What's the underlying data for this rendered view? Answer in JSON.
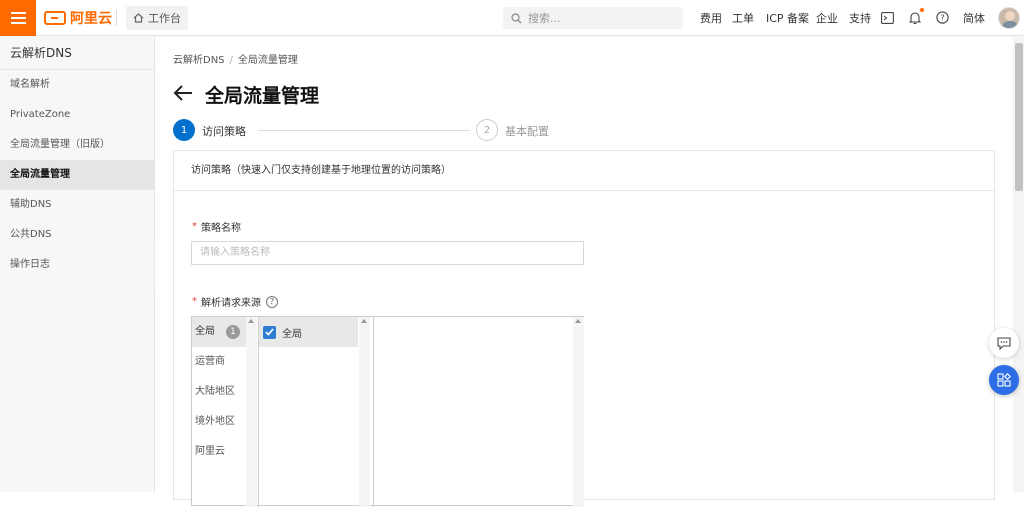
{
  "topbar": {
    "brand": "阿里云",
    "workbench_label": "工作台",
    "search_placeholder": "搜索...",
    "nav": [
      "费用",
      "工单",
      "ICP 备案",
      "企业",
      "支持"
    ],
    "language": "简体"
  },
  "sidebar": {
    "title": "云解析DNS",
    "items": [
      {
        "label": "域名解析",
        "active": false
      },
      {
        "label": "PrivateZone",
        "active": false
      },
      {
        "label": "全局流量管理（旧版）",
        "active": false
      },
      {
        "label": "全局流量管理",
        "active": true
      },
      {
        "label": "辅助DNS",
        "active": false
      },
      {
        "label": "公共DNS",
        "active": false
      },
      {
        "label": "操作日志",
        "active": false
      }
    ]
  },
  "breadcrumb": {
    "root": "云解析DNS",
    "current": "全局流量管理"
  },
  "page": {
    "title": "全局流量管理"
  },
  "steps": [
    {
      "number": "1",
      "label": "访问策略",
      "active": true
    },
    {
      "number": "2",
      "label": "基本配置",
      "active": false
    }
  ],
  "form": {
    "section_title": "访问策略（快速入门仅支持创建基于地理位置的访问策略）",
    "policy_name_label": "策略名称",
    "policy_name_placeholder": "请输入策略名称",
    "source_label": "解析请求来源",
    "source_categories": [
      {
        "label": "全局",
        "count": "1",
        "selected": true
      },
      {
        "label": "运营商",
        "selected": false
      },
      {
        "label": "大陆地区",
        "selected": false
      },
      {
        "label": "境外地区",
        "selected": false
      },
      {
        "label": "阿里云",
        "selected": false
      }
    ],
    "source_options": [
      {
        "label": "全局",
        "checked": true
      }
    ]
  },
  "colors": {
    "brand_orange": "#ff6a00",
    "primary_blue": "#0070cc",
    "required_red": "#e53935"
  }
}
